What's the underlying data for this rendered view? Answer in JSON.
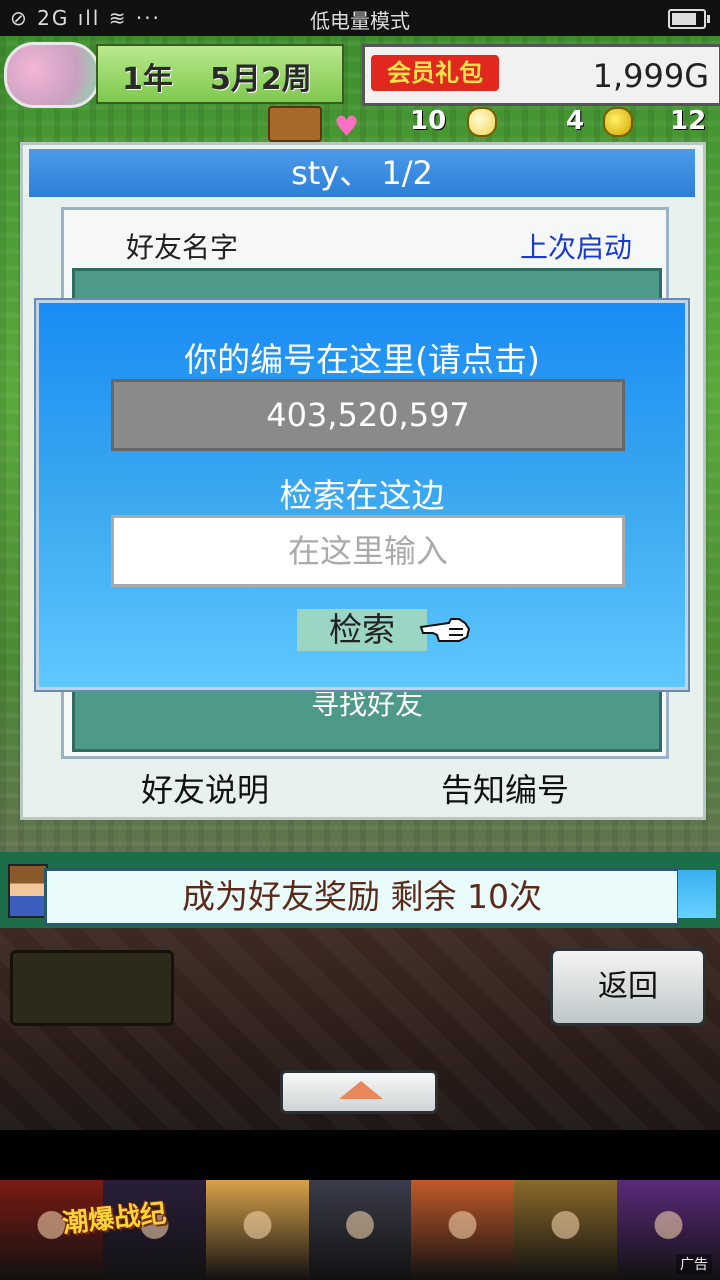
{
  "status_bar": {
    "left_indicators": "⊘ 2G ıll ≋ ···",
    "center_text": "低电量模式",
    "battery_level": 0.7
  },
  "hud": {
    "year": "1年",
    "month_week": "5月2周",
    "vip_button": "会员礼包",
    "gold": "1,999G",
    "resources": [
      {
        "label": "10",
        "icon": "bulb-icon"
      },
      {
        "label": "4",
        "icon": "coin-icon"
      },
      {
        "label": "12",
        "icon": "coin-icon"
      }
    ]
  },
  "dialog": {
    "title": "sty、 1/2",
    "column_name": "好友名字",
    "column_last_login": "上次启动",
    "find_friends": "寻找好友",
    "friend_help": "好友说明",
    "share_id": "告知编号"
  },
  "overlay": {
    "title": "你的编号在这里(请点击)",
    "player_id": "403,520,597",
    "search_label": "检索在这边",
    "search_placeholder": "在这里输入",
    "search_button": "检索"
  },
  "reward": {
    "text": "成为好友奖励 剩余 10次"
  },
  "console": {
    "back_button": "返回"
  },
  "ad": {
    "logo": "潮爆战纪",
    "tag": "广告",
    "tile_colors": [
      "#7a1a12",
      "#2a1e3a",
      "#d9a24a",
      "#3a3c4a",
      "#c25a2a",
      "#8a6a2a",
      "#5a2a7a"
    ]
  }
}
